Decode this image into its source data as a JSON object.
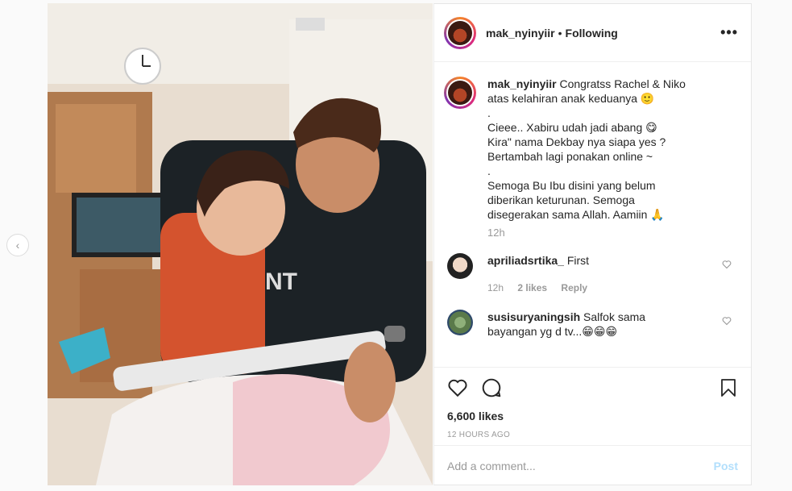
{
  "header": {
    "username": "mak_nyinyiir",
    "separator": "•",
    "follow_status": "Following",
    "more_label": "•••"
  },
  "caption": {
    "username": "mak_nyinyiir",
    "lines": [
      "Congratss Rachel & Niko atas kelahiran anak keduanya 🙂",
      ".",
      "Cieee.. Xabiru udah jadi abang 😋",
      "Kira\" nama Dekbay nya siapa yes ?",
      "Bertambah lagi ponakan online ~",
      ".",
      "Semoga Bu Ibu disini yang belum diberikan keturunan. Semoga disegerakan sama Allah. Aamiin 🙏"
    ],
    "time": "12h"
  },
  "comments": [
    {
      "username": "apriliadsrtika_",
      "text": "First",
      "time": "12h",
      "likes": "2 likes",
      "reply": "Reply"
    },
    {
      "username": "susisuryaningsih",
      "text": "Salfok sama bayangan yg d tv...😁😁😁"
    }
  ],
  "actions": {
    "like_icon": "heart-icon",
    "comment_icon": "comment-icon",
    "save_icon": "bookmark-icon"
  },
  "likes": "6,600 likes",
  "posted": "12 HOURS AGO",
  "add_comment": {
    "placeholder": "Add a comment...",
    "post_label": "Post"
  },
  "nav": {
    "prev_icon": "chevron-left-icon",
    "next_icon": "chevron-right-icon",
    "prev_glyph": "‹",
    "next_glyph": "›"
  },
  "colors": {
    "link_disabled": "#b2dffc",
    "muted": "#999999",
    "text": "#262626"
  }
}
